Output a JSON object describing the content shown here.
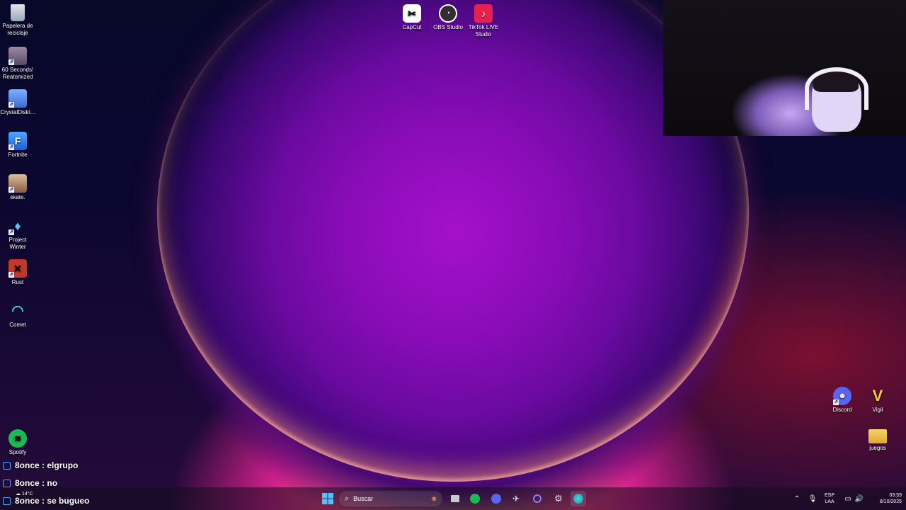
{
  "desktop": {
    "left_icons": [
      {
        "label_line1": "Papelera de",
        "label_line2": "reciclaje",
        "icon": "recycle-bin-icon"
      },
      {
        "label_line1": "60 Seconds!",
        "label_line2": "Reatomized",
        "icon": "60-seconds-game-icon"
      },
      {
        "label_line1": "CrystalDiskI...",
        "label_line2": "",
        "icon": "crystaldiskinfo-icon"
      },
      {
        "label_line1": "Fortnite",
        "label_line2": "",
        "icon": "fortnite-icon"
      },
      {
        "label_line1": "skate.",
        "label_line2": "",
        "icon": "skate-game-icon"
      },
      {
        "label_line1": "Project",
        "label_line2": "Winter",
        "icon": "project-winter-icon"
      },
      {
        "label_line1": "Rust",
        "label_line2": "",
        "icon": "rust-game-icon"
      },
      {
        "label_line1": "Comet",
        "label_line2": "",
        "icon": "comet-browser-icon"
      },
      {
        "label_line1": "Spotify",
        "label_line2": "",
        "icon": "spotify-icon"
      }
    ],
    "top_icons": [
      {
        "label_line1": "CapCut",
        "label_line2": "",
        "icon": "capcut-icon"
      },
      {
        "label_line1": "OBS Studio",
        "label_line2": "",
        "icon": "obs-studio-icon"
      },
      {
        "label_line1": "TikTok LIVE",
        "label_line2": "Studio",
        "icon": "tiktok-live-studio-icon"
      }
    ],
    "right_icons": [
      {
        "label_line1": "Discord",
        "label_line2": "",
        "icon": "discord-icon"
      },
      {
        "label_line1": "Vigil",
        "label_line2": "",
        "icon": "vigil-icon"
      },
      {
        "label_line1": "juegos",
        "label_line2": "",
        "icon": "folder-icon"
      }
    ]
  },
  "chat_overlay": [
    {
      "user": "8once",
      "message": "elgrupo"
    },
    {
      "user": "8once",
      "message": "no"
    },
    {
      "user": "8once",
      "message": "se bugueo"
    }
  ],
  "taskbar": {
    "weather_temp": "14°C",
    "search_placeholder": "Buscar",
    "apps": [
      "start-icon",
      "search-icon",
      "file-explorer-icon",
      "spotify-icon",
      "discord-icon",
      "steam-icon",
      "app-icon",
      "chatgpt-icon",
      "browser-icon"
    ],
    "language_line1": "ESP",
    "language_line2": "LAA",
    "time": "03:59",
    "date": "8/10/2025"
  },
  "colors": {
    "accent": "#a411c9",
    "twitch_icon": "#4da3ff",
    "spotify": "#1db954",
    "discord": "#5865f2"
  }
}
